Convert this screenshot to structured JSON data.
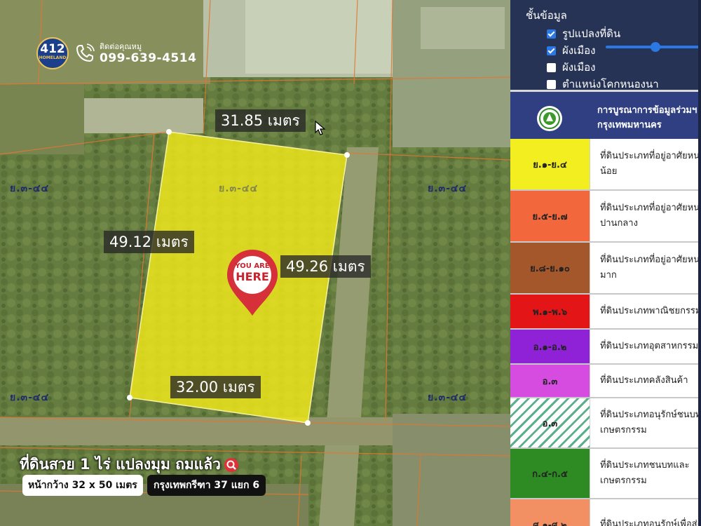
{
  "brand": {
    "logo_number": "412",
    "logo_text": "HOMELAND",
    "contact_label": "ติดต่อคุณหมู",
    "phone": "099-639-4514"
  },
  "map": {
    "dimensions": {
      "top": "31.85 เมตร",
      "left": "49.12 เมตร",
      "right": "49.26 เมตร",
      "bottom": "32.00 เมตร"
    },
    "zone_code": "ย.๓-๔๔",
    "pin": {
      "line1": "YOU ARE",
      "line2": "HERE",
      "color": "#d6303b"
    },
    "plot_color": "#f2ea1a"
  },
  "promo": {
    "title": "ที่ดินสวย 1 ไร่ แปลงมุม ถมแล้ว",
    "size": "หน้ากว้าง 32 x 50 เมตร",
    "location": "กรุงเทพกรีฑา 37 แยก 6"
  },
  "panel": {
    "layers_title": "ชั้นข้อมูล",
    "layers": [
      {
        "label": "รูปแปลงที่ดิน",
        "checked": true
      },
      {
        "label": "ผังเมือง",
        "checked": true
      },
      {
        "label": "ผังเมือง",
        "checked": false
      },
      {
        "label": "ตำแหน่งโคกหนองนา",
        "checked": false
      }
    ],
    "legend_title_line1": "การบูรณาการข้อมูลร่วมฯ",
    "legend_title_line2": "กรุงเทพมหานคร",
    "legend": [
      {
        "code": "ย.๑-ย.๔",
        "desc": "ที่ดินประเภทที่อยู่อาศัยหนาแน่น\nน้อย",
        "color": "#f2ee1f"
      },
      {
        "code": "ย.๕-ย.๗",
        "desc": "ที่ดินประเภทที่อยู่อาศัยหนาแน่น\nปานกลาง",
        "color": "#f2683c"
      },
      {
        "code": "ย.๘-ย.๑๐",
        "desc": "ที่ดินประเภทที่อยู่อาศัยหนาแน่น\nมาก",
        "color": "#a4572a"
      },
      {
        "code": "พ.๑-พ.๖",
        "desc": "ที่ดินประเภทพาณิชยกรรม",
        "color": "#e41517"
      },
      {
        "code": "อ.๑-อ.๒",
        "desc": "ที่ดินประเภทอุตสาหกรรม",
        "color": "#8f22d6"
      },
      {
        "code": "อ.๓",
        "desc": "ที่ดินประเภทคลังสินค้า",
        "color": "#d64be0"
      },
      {
        "code": "อ.๓",
        "desc": "ที่ดินประเภทอนุรักษ์ชนบทและ\nเกษตรกรรม",
        "color": "hatch-green"
      },
      {
        "code": "ก.๔-ก.๕",
        "desc": "ที่ดินประเภทชนบทและ\nเกษตรกรรม",
        "color": "#2e8a22"
      },
      {
        "code": "ศ.๑-ศ.๒",
        "desc": "ที่ดินประเภทอนุรักษ์เพื่อส่ง",
        "color": "#f28f63"
      }
    ]
  }
}
